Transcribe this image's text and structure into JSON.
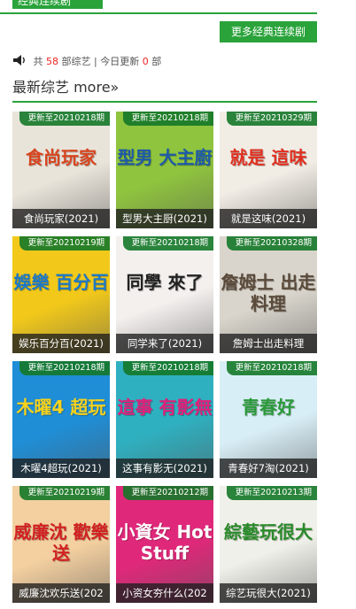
{
  "header": {
    "section_title": "经典连续剧",
    "more_button": "更多经典连续剧"
  },
  "stats": {
    "prefix": "共",
    "count": "58",
    "middle": "部综艺 | 今日更新",
    "today": "0",
    "suffix": "部"
  },
  "variety": {
    "title": "最新综艺 more»"
  },
  "cards": [
    {
      "badge": "更新至20210218期",
      "caption": "食尚玩家(2021)",
      "art": "食尚玩家",
      "bg": "#e9e4da",
      "accent": "#d8451f"
    },
    {
      "badge": "更新至20210218期",
      "caption": "型男大主厨(2021)",
      "art": "型男 大主廚",
      "bg": "#8fc43e",
      "accent": "#1d5aa8"
    },
    {
      "badge": "更新至20210329期",
      "caption": "就是这味(2021)",
      "art": "就是 這味",
      "bg": "#f1ece4",
      "accent": "#e03020"
    },
    {
      "badge": "更新至20210219期",
      "caption": "娱乐百分百(2021)",
      "art": "娛樂 百分百",
      "bg": "#f2c91a",
      "accent": "#1c78c8"
    },
    {
      "badge": "更新至20210218期",
      "caption": "同学来了(2021)",
      "art": "同學 來了",
      "bg": "#f3f0ee",
      "accent": "#222222"
    },
    {
      "badge": "更新至20210328期",
      "caption": "詹姆士出走料理",
      "art": "詹姆士 出走料理",
      "bg": "#d9d5cc",
      "accent": "#5a4a3a"
    },
    {
      "badge": "更新至20210218期",
      "caption": "木曜4超玩(2021)",
      "art": "木曜4 超玩",
      "bg": "#1f8ed6",
      "accent": "#f7d21c"
    },
    {
      "badge": "更新至20210218期",
      "caption": "这事有影无(2021)",
      "art": "這事 有影無",
      "bg": "#2fb0c0",
      "accent": "#e0207a"
    },
    {
      "badge": "更新至20210218期",
      "caption": "青春好7淘(2021)",
      "art": "青春好",
      "bg": "#d8eef6",
      "accent": "#2a9a3a"
    },
    {
      "badge": "更新至20210219期",
      "caption": "威廉沈欢乐送(202",
      "art": "威廉沈 歡樂送",
      "bg": "#f4d0a0",
      "accent": "#d22020"
    },
    {
      "badge": "更新至20210212期",
      "caption": "小资女夯什么(202",
      "art": "小資女 Hot Stuff",
      "bg": "#e0287a",
      "accent": "#ffffff"
    },
    {
      "badge": "更新至20210213期",
      "caption": "综艺玩很大(2021)",
      "art": "綜藝玩很大",
      "bg": "#f0f0ea",
      "accent": "#2a8a2a"
    }
  ]
}
